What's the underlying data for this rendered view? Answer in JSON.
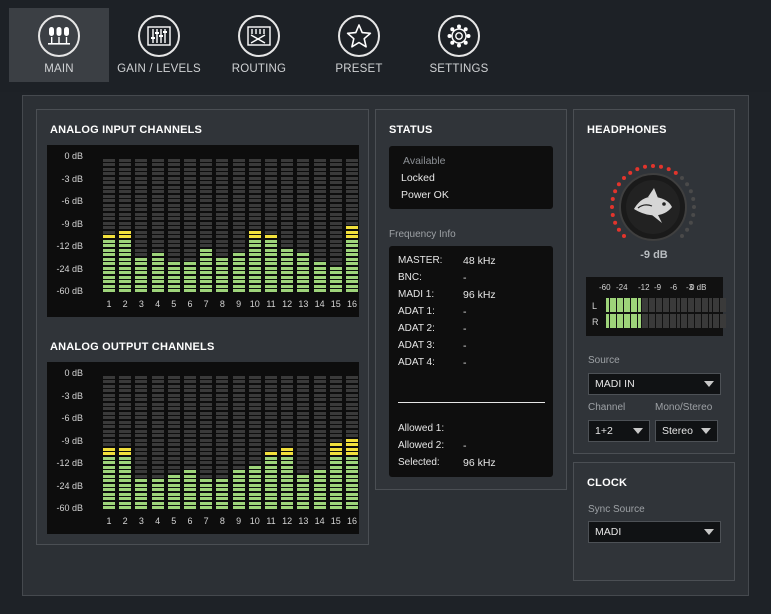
{
  "nav": {
    "items": [
      {
        "label": "MAIN",
        "icon": "mic-icon",
        "active": true
      },
      {
        "label": "GAIN / LEVELS",
        "icon": "faders-icon",
        "active": false
      },
      {
        "label": "ROUTING",
        "icon": "routing-icon",
        "active": false
      },
      {
        "label": "PRESET",
        "icon": "star-icon",
        "active": false
      },
      {
        "label": "SETTINGS",
        "icon": "gear-icon",
        "active": false
      }
    ]
  },
  "analog_input": {
    "title": "ANALOG INPUT CHANNELS",
    "db_labels": [
      "0 dB",
      "-3 dB",
      "-6 dB",
      "-9 dB",
      "-12 dB",
      "-24 dB",
      "-60 dB"
    ],
    "channels": [
      "1",
      "2",
      "3",
      "4",
      "5",
      "6",
      "7",
      "8",
      "9",
      "10",
      "11",
      "12",
      "13",
      "14",
      "15",
      "16"
    ],
    "levels": [
      13,
      14,
      8,
      9,
      7,
      7,
      10,
      8,
      9,
      14,
      13,
      10,
      9,
      7,
      6,
      15
    ]
  },
  "analog_output": {
    "title": "ANALOG OUTPUT CHANNELS",
    "db_labels": [
      "0 dB",
      "-3 dB",
      "-6 dB",
      "-9 dB",
      "-12 dB",
      "-24 dB",
      "-60 dB"
    ],
    "channels": [
      "1",
      "2",
      "3",
      "4",
      "5",
      "6",
      "7",
      "8",
      "9",
      "10",
      "11",
      "12",
      "13",
      "14",
      "15",
      "16"
    ],
    "levels": [
      14,
      14,
      7,
      7,
      8,
      9,
      7,
      7,
      9,
      10,
      13,
      14,
      8,
      9,
      15,
      16
    ]
  },
  "status": {
    "title": "STATUS",
    "available": "Available",
    "locked": "Locked",
    "power": "Power OK",
    "freq_info_label": "Frequency Info",
    "freq_rows": [
      {
        "label": "MASTER:",
        "value": "48 kHz"
      },
      {
        "label": "BNC:",
        "value": "-"
      },
      {
        "label": "MADI 1:",
        "value": "96 kHz"
      },
      {
        "label": "ADAT 1:",
        "value": "-"
      },
      {
        "label": "ADAT 2:",
        "value": "-"
      },
      {
        "label": "ADAT 3:",
        "value": "-"
      },
      {
        "label": "ADAT 4:",
        "value": "-"
      }
    ],
    "allowed_rows": [
      {
        "label": "Allowed 1:",
        "value": ""
      },
      {
        "label": "Allowed 2:",
        "value": "-"
      },
      {
        "label": "Selected:",
        "value": "96 kHz"
      }
    ]
  },
  "headphones": {
    "title": "HEADPHONES",
    "volume": "-9 dB",
    "knob_fraction": 0.62,
    "meter_scale": [
      "-60",
      "-24",
      "-12",
      "-9",
      "-6",
      "-3",
      "0 dB"
    ],
    "ch_left": "L",
    "ch_right": "R",
    "level_left": 0.3,
    "level_right": 0.3,
    "source_label": "Source",
    "source_value": "MADI IN",
    "channel_label": "Channel",
    "channel_value": "1+2",
    "mono_label": "Mono/Stereo",
    "mono_value": "Stereo"
  },
  "clock": {
    "title": "CLOCK",
    "sync_label": "Sync Source",
    "sync_value": "MADI"
  },
  "colors": {
    "green": "#9ed47a",
    "yellow": "#f2e03c",
    "unlit": "#3a3a3a",
    "knob_red": "#e2342c"
  }
}
